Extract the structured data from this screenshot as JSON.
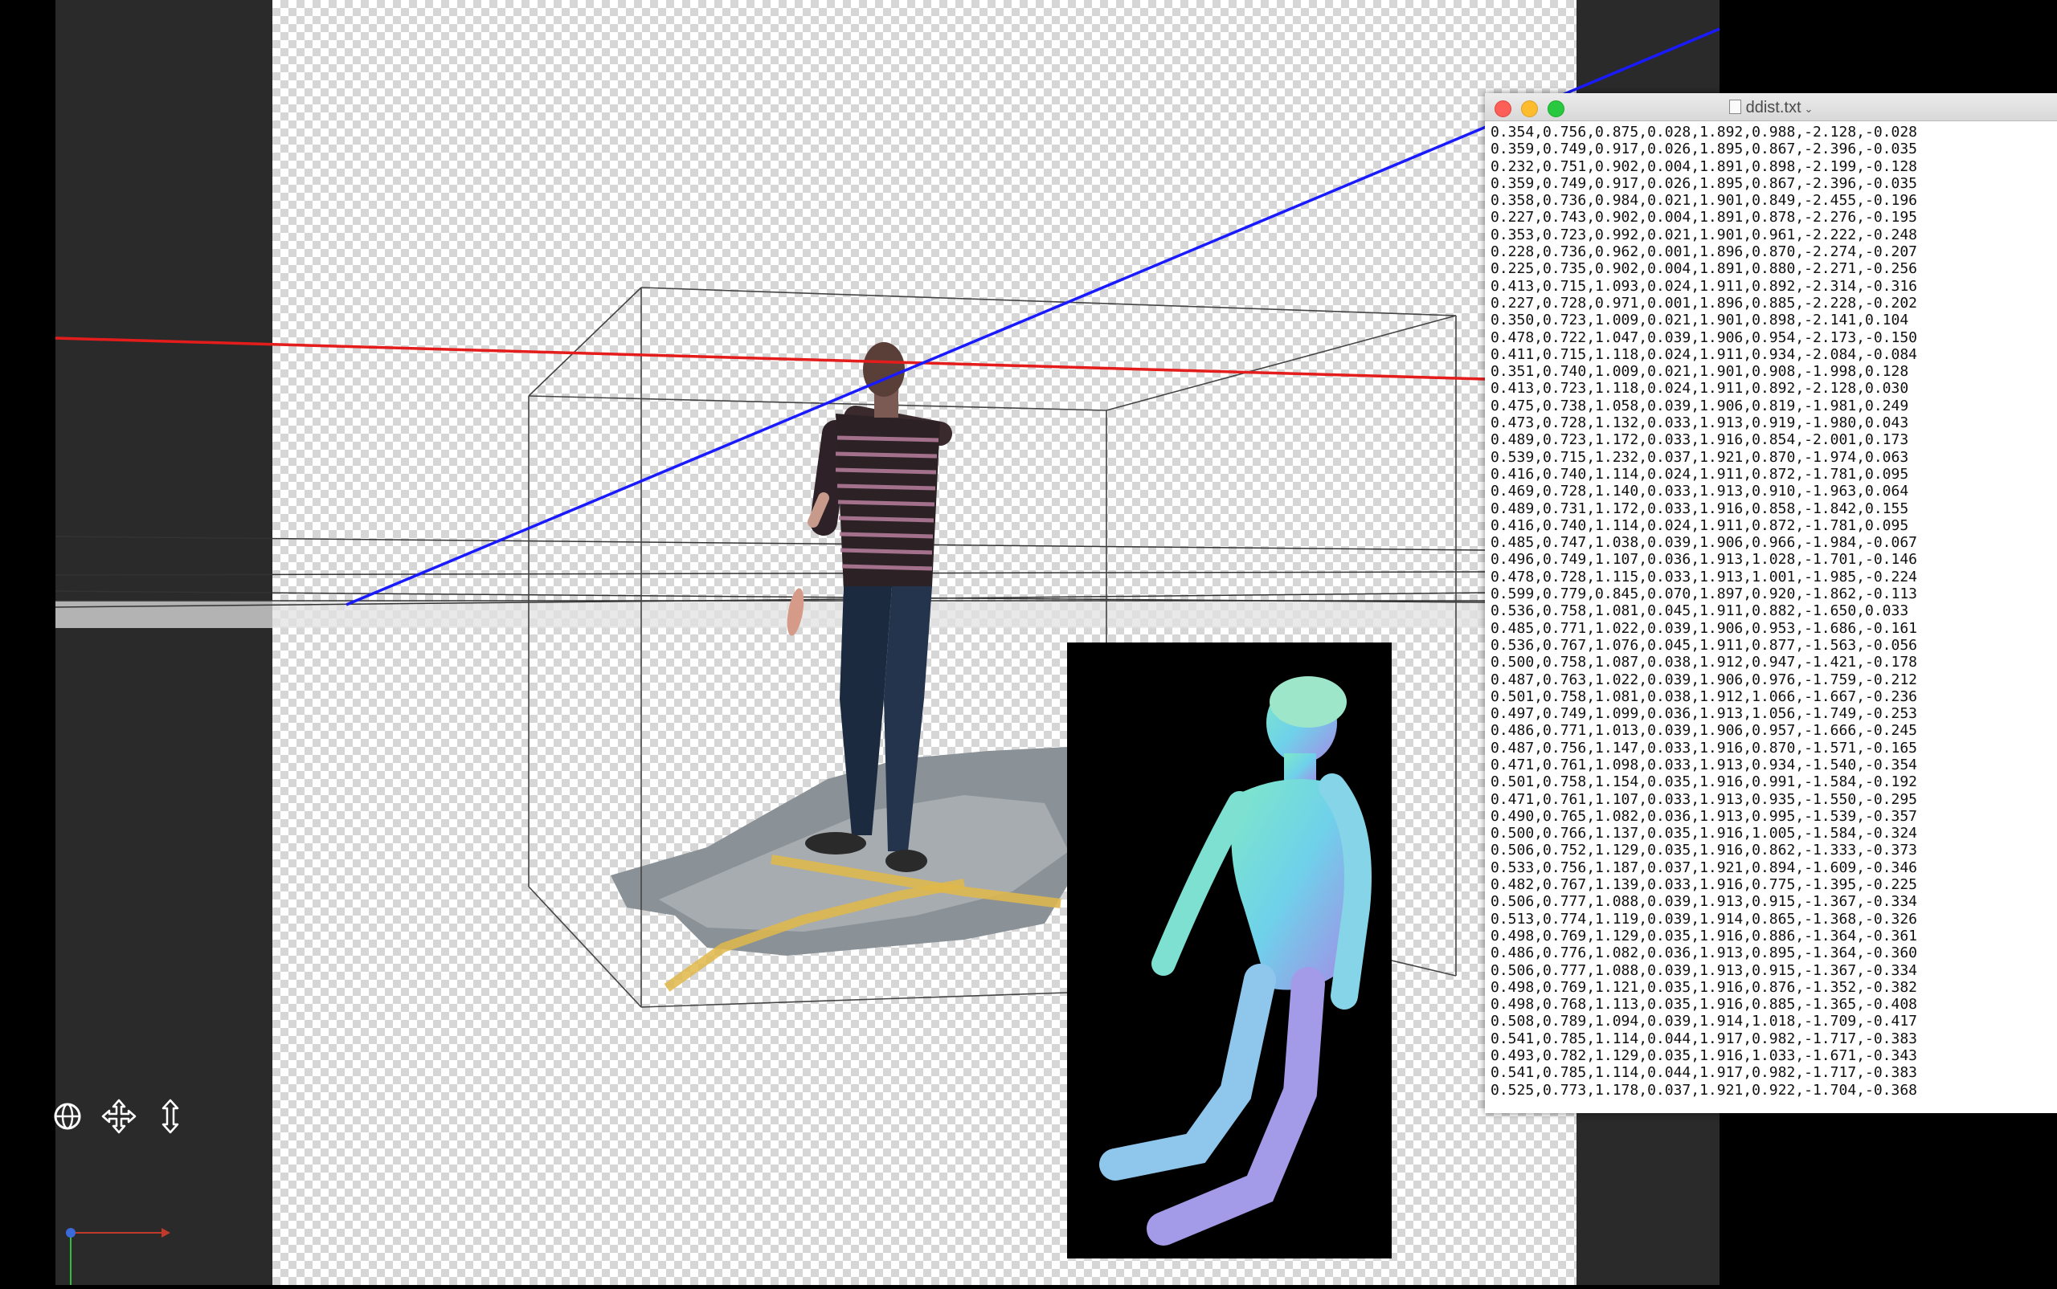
{
  "window": {
    "file_name": "ddist.txt"
  },
  "icons": {
    "rotate": "globe-rotate-icon",
    "pan": "four-way-arrow-icon",
    "zoom": "vertical-arrow-icon",
    "close": "close-icon",
    "minimize": "minimize-icon",
    "maximize": "maximize-icon",
    "chevron": "chevron-down-icon"
  },
  "colors": {
    "x_axis": "#e51c1c",
    "z_axis": "#1a1aff",
    "panel_bg": "#2a2a2a"
  },
  "lines": [
    "0.354,0.756,0.875,0.028,1.892,0.988,-2.128,-0.028",
    "0.359,0.749,0.917,0.026,1.895,0.867,-2.396,-0.035",
    "0.232,0.751,0.902,0.004,1.891,0.898,-2.199,-0.128",
    "0.359,0.749,0.917,0.026,1.895,0.867,-2.396,-0.035",
    "0.358,0.736,0.984,0.021,1.901,0.849,-2.455,-0.196",
    "0.227,0.743,0.902,0.004,1.891,0.878,-2.276,-0.195",
    "0.353,0.723,0.992,0.021,1.901,0.961,-2.222,-0.248",
    "0.228,0.736,0.962,0.001,1.896,0.870,-2.274,-0.207",
    "0.225,0.735,0.902,0.004,1.891,0.880,-2.271,-0.256",
    "0.413,0.715,1.093,0.024,1.911,0.892,-2.314,-0.316",
    "0.227,0.728,0.971,0.001,1.896,0.885,-2.228,-0.202",
    "0.350,0.723,1.009,0.021,1.901,0.898,-2.141,0.104",
    "0.478,0.722,1.047,0.039,1.906,0.954,-2.173,-0.150",
    "0.411,0.715,1.118,0.024,1.911,0.934,-2.084,-0.084",
    "0.351,0.740,1.009,0.021,1.901,0.908,-1.998,0.128",
    "0.413,0.723,1.118,0.024,1.911,0.892,-2.128,0.030",
    "0.475,0.738,1.058,0.039,1.906,0.819,-1.981,0.249",
    "0.473,0.728,1.132,0.033,1.913,0.919,-1.980,0.043",
    "0.489,0.723,1.172,0.033,1.916,0.854,-2.001,0.173",
    "0.539,0.715,1.232,0.037,1.921,0.870,-1.974,0.063",
    "0.416,0.740,1.114,0.024,1.911,0.872,-1.781,0.095",
    "0.469,0.728,1.140,0.033,1.913,0.910,-1.963,0.064",
    "0.489,0.731,1.172,0.033,1.916,0.858,-1.842,0.155",
    "0.416,0.740,1.114,0.024,1.911,0.872,-1.781,0.095",
    "0.485,0.747,1.038,0.039,1.906,0.966,-1.984,-0.067",
    "0.496,0.749,1.107,0.036,1.913,1.028,-1.701,-0.146",
    "0.478,0.728,1.115,0.033,1.913,1.001,-1.985,-0.224",
    "0.599,0.779,0.845,0.070,1.897,0.920,-1.862,-0.113",
    "0.536,0.758,1.081,0.045,1.911,0.882,-1.650,0.033",
    "0.485,0.771,1.022,0.039,1.906,0.953,-1.686,-0.161",
    "0.536,0.767,1.076,0.045,1.911,0.877,-1.563,-0.056",
    "0.500,0.758,1.087,0.038,1.912,0.947,-1.421,-0.178",
    "0.487,0.763,1.022,0.039,1.906,0.976,-1.759,-0.212",
    "0.501,0.758,1.081,0.038,1.912,1.066,-1.667,-0.236",
    "0.497,0.749,1.099,0.036,1.913,1.056,-1.749,-0.253",
    "0.486,0.771,1.013,0.039,1.906,0.957,-1.666,-0.245",
    "0.487,0.756,1.147,0.033,1.916,0.870,-1.571,-0.165",
    "0.471,0.761,1.098,0.033,1.913,0.934,-1.540,-0.354",
    "0.501,0.758,1.154,0.035,1.916,0.991,-1.584,-0.192",
    "0.471,0.761,1.107,0.033,1.913,0.935,-1.550,-0.295",
    "0.490,0.765,1.082,0.036,1.913,0.995,-1.539,-0.357",
    "0.500,0.766,1.137,0.035,1.916,1.005,-1.584,-0.324",
    "0.506,0.752,1.129,0.035,1.916,0.862,-1.333,-0.373",
    "0.533,0.756,1.187,0.037,1.921,0.894,-1.609,-0.346",
    "0.482,0.767,1.139,0.033,1.916,0.775,-1.395,-0.225",
    "0.506,0.777,1.088,0.039,1.913,0.915,-1.367,-0.334",
    "0.513,0.774,1.119,0.039,1.914,0.865,-1.368,-0.326",
    "0.498,0.769,1.129,0.035,1.916,0.886,-1.364,-0.361",
    "0.486,0.776,1.082,0.036,1.913,0.895,-1.364,-0.360",
    "0.506,0.777,1.088,0.039,1.913,0.915,-1.367,-0.334",
    "0.498,0.769,1.121,0.035,1.916,0.876,-1.352,-0.382",
    "0.498,0.768,1.113,0.035,1.916,0.885,-1.365,-0.408",
    "0.508,0.789,1.094,0.039,1.914,1.018,-1.709,-0.417",
    "0.541,0.785,1.114,0.044,1.917,0.982,-1.717,-0.383",
    "0.493,0.782,1.129,0.035,1.916,1.033,-1.671,-0.343",
    "0.541,0.785,1.114,0.044,1.917,0.982,-1.717,-0.383",
    "0.525,0.773,1.178,0.037,1.921,0.922,-1.704,-0.368"
  ]
}
